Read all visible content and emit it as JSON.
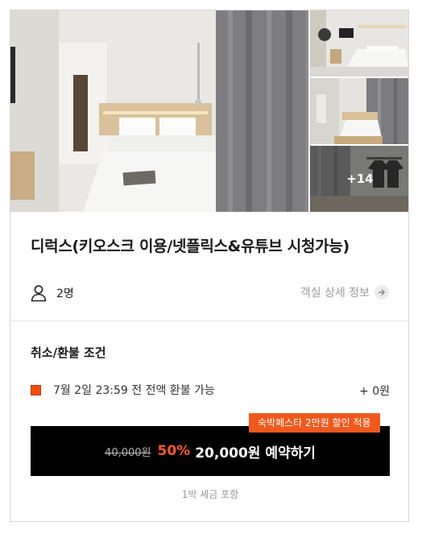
{
  "gallery": {
    "more_count_label": "+14",
    "main_alt": "room-main",
    "thumbs": [
      "room-thumb-1",
      "room-thumb-2",
      "room-thumb-3"
    ]
  },
  "room": {
    "title": "디럭스(키오스크 이용/넷플릭스&유튜브 시청가능)",
    "guests": "2명",
    "detail_link": "객실 상세 정보"
  },
  "refund": {
    "section_title": "취소/환불 조건",
    "condition": "7월 2일 23:59 전 전액 환불 가능",
    "amount": "+ 0원",
    "indicator_color": "#f04d0a"
  },
  "booking": {
    "promo_badge": "숙박페스타 2만원 할인 적용",
    "original_price": "40,000원",
    "discount": "50%",
    "button_label": "20,000원 예약하기",
    "tax_note": "1박 세금 포함"
  },
  "colors": {
    "accent": "#f0591e",
    "discount": "#ff5a2c",
    "button_bg": "#000000"
  },
  "icons": {
    "guest": "person-icon",
    "detail_arrow": "arrow-right-icon"
  }
}
